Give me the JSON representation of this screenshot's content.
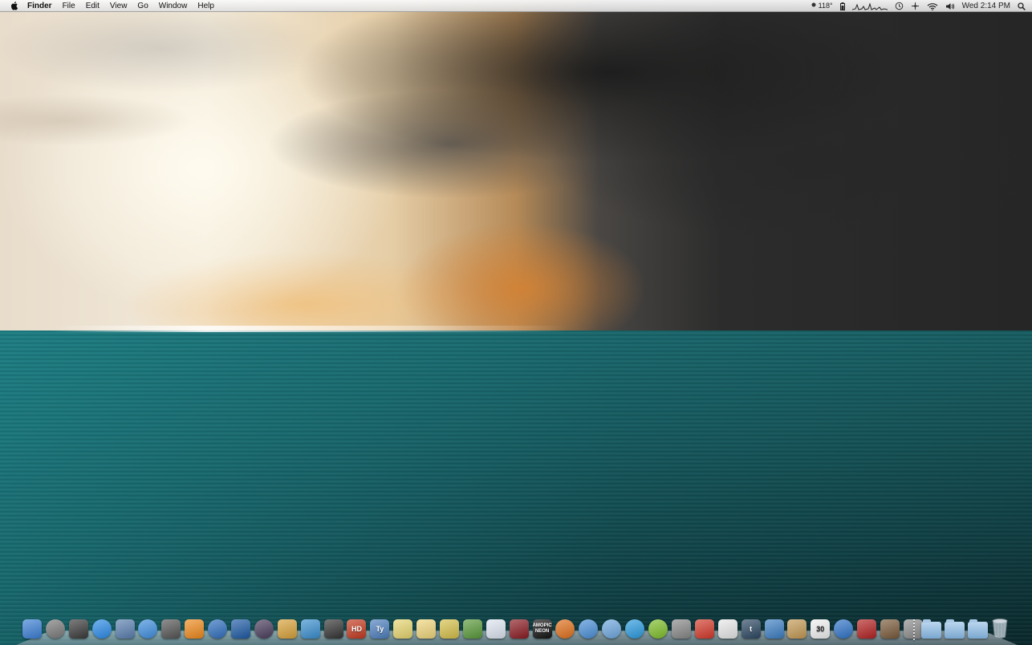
{
  "menubar": {
    "app_name": "Finder",
    "menus": [
      "File",
      "Edit",
      "View",
      "Go",
      "Window",
      "Help"
    ],
    "status": {
      "temperature": "118°",
      "clock": "Wed 2:14 PM"
    }
  },
  "dock": {
    "apps": [
      {
        "icon": "finder-icon",
        "color": "#3b7fd6"
      },
      {
        "icon": "launchpad-icon",
        "color": "#7a7a7a"
      },
      {
        "icon": "mission-control-icon",
        "color": "#3a3a3a"
      },
      {
        "icon": "app-store-icon",
        "color": "#2b8be8"
      },
      {
        "icon": "preview-icon",
        "color": "#5a7fb0"
      },
      {
        "icon": "safari-icon",
        "color": "#3f8fe0"
      },
      {
        "icon": "facetime-icon",
        "color": "#555555"
      },
      {
        "icon": "vlc-icon",
        "color": "#f08a1c"
      },
      {
        "icon": "quicktime-icon",
        "color": "#2f6fbf"
      },
      {
        "icon": "photo-booth-icon",
        "color": "#1d5aa5"
      },
      {
        "icon": "alfred-icon",
        "color": "#4a3c5c"
      },
      {
        "icon": "paint-icon",
        "color": "#d9a23a"
      },
      {
        "icon": "downloader-icon",
        "color": "#3a8fd0"
      },
      {
        "icon": "radio-icon",
        "color": "#333333"
      },
      {
        "icon": "hd-wallpaper-icon",
        "color": "#c4391e",
        "label": "HD"
      },
      {
        "icon": "typora-icon",
        "color": "#4d7fbf",
        "label": "Ty"
      },
      {
        "icon": "stickies-icon",
        "color": "#e8d770"
      },
      {
        "icon": "notes-icon",
        "color": "#f1d77c"
      },
      {
        "icon": "notepad-icon",
        "color": "#d7c14a"
      },
      {
        "icon": "evernote-icon",
        "color": "#5a9a3a"
      },
      {
        "icon": "cursor-icon",
        "color": "#dfe6f2"
      },
      {
        "icon": "photo-booth-alt-icon",
        "color": "#8b1b22"
      },
      {
        "icon": "amopic-neon-icon",
        "color": "#111111",
        "label": "AMOPIC NEON"
      },
      {
        "icon": "firefox-icon",
        "color": "#e2701c"
      },
      {
        "icon": "chrome-icon",
        "color": "#4a90d9"
      },
      {
        "icon": "itunes-play-icon",
        "color": "#6ea8e0"
      },
      {
        "icon": "sync-icon",
        "color": "#2b9be0"
      },
      {
        "icon": "spotify-icon",
        "color": "#7fbf2a"
      },
      {
        "icon": "scanner-icon",
        "color": "#888888"
      },
      {
        "icon": "network-icon",
        "color": "#d43a2a"
      },
      {
        "icon": "coffee-icon",
        "color": "#e9e9e9"
      },
      {
        "icon": "tumblr-icon",
        "color": "#2c4762",
        "label": "t"
      },
      {
        "icon": "twitter-icon",
        "color": "#3d7fc4"
      },
      {
        "icon": "contacts-icon",
        "color": "#c49a55"
      },
      {
        "icon": "calendar-icon",
        "color": "#f2f2f2",
        "label": "30"
      },
      {
        "icon": "music-icon",
        "color": "#2f74c9"
      },
      {
        "icon": "photo-album-icon",
        "color": "#b42222"
      },
      {
        "icon": "iphoto-icon",
        "color": "#7a5a3a"
      },
      {
        "icon": "system-preferences-icon",
        "color": "#8c8c8c"
      }
    ],
    "stacks": [
      "applications-stack-icon",
      "documents-stack-icon",
      "downloads-stack-icon"
    ]
  }
}
